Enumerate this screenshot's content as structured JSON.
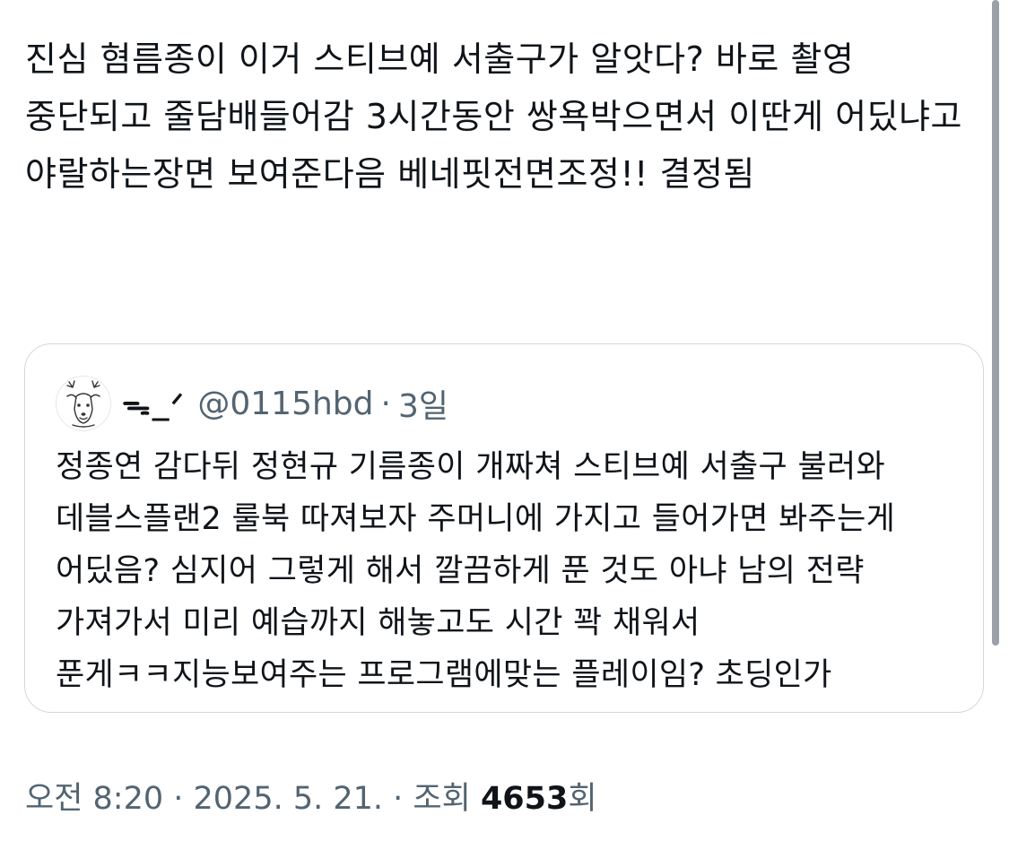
{
  "tweet": {
    "text": "진심 혐름종이 이거 스티브예 서출구가 알앗다? 바로 촬영 중단되고 줄담배들어감 3시간동안 쌍욕박으면서 이딴게 어딨냐고 야랄하는장면 보여준다음 베네핏전면조정!! 결정됨"
  },
  "quote": {
    "display_name": "ᯓ_ᐟ",
    "handle": "@0115hbd",
    "separator": "·",
    "age": "3일",
    "avatar_icon": "deer-avatar-icon",
    "text": "정종연 감다뒤 정현규 기름종이 개짜쳐 스티브예 서출구 불러와 데블스플랜2 룰북 따져보자 주머니에 가지고 들어가면 봐주는게 어딨음? 심지어 그렇게 해서 깔끔하게 푼 것도 아냐 남의 전략 가져가서 미리 예습까지 해놓고도 시간 꽉 채워서 푼게ㅋㅋ지능보여주는 프로그램에맞는 플레이임? 초딩인가"
  },
  "meta": {
    "time": "오전 8:20",
    "sep1": " · ",
    "date": "2025. 5. 21.",
    "sep2": " · ",
    "views_label": "조회 ",
    "views_count": "4653",
    "views_suffix": "회"
  },
  "colors": {
    "text": "#0f1419",
    "secondary": "#536471",
    "border": "#cfd9de"
  }
}
